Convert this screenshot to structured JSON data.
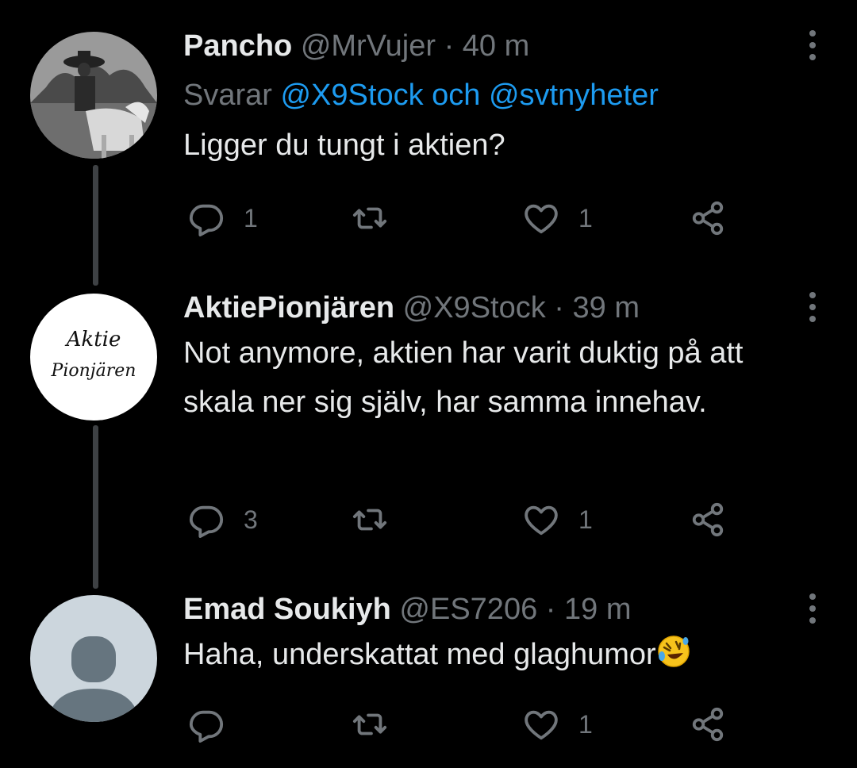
{
  "tweets": [
    {
      "name": "Pancho",
      "handle": "@MrVujer",
      "time": "40 m",
      "reply_prefix": "Svarar",
      "reply_mention_1": "@X9Stock",
      "reply_join": "och",
      "reply_mention_2": "@svtnyheter",
      "text": "Ligger du tungt i aktien?",
      "reply_count": "1",
      "retweet_count": "",
      "like_count": "1"
    },
    {
      "name": "AktiePionjären",
      "handle": "@X9Stock",
      "time": "39 m",
      "avatar_line_1": "Aktie",
      "avatar_line_2": "Pionjären",
      "text": "Not anymore, aktien har varit duktig på att skala ner sig själv, har samma innehav.",
      "reply_count": "3",
      "retweet_count": "",
      "like_count": "1"
    },
    {
      "name": "Emad Soukiyh",
      "handle": "@ES7206",
      "time": "19 m",
      "text": "Haha, underskattat med glaghumor",
      "emoji": "rolling-on-floor-laughing-emoji",
      "reply_count": "",
      "retweet_count": "",
      "like_count": "1"
    }
  ],
  "separator": "·",
  "colors": {
    "background": "#000000",
    "text": "#e7e9ea",
    "muted": "#71767b",
    "mention": "#1d9bf0",
    "thread_line": "#3e4144"
  },
  "icons": [
    "reply-icon",
    "retweet-icon",
    "like-icon",
    "share-icon",
    "more-options-icon"
  ]
}
